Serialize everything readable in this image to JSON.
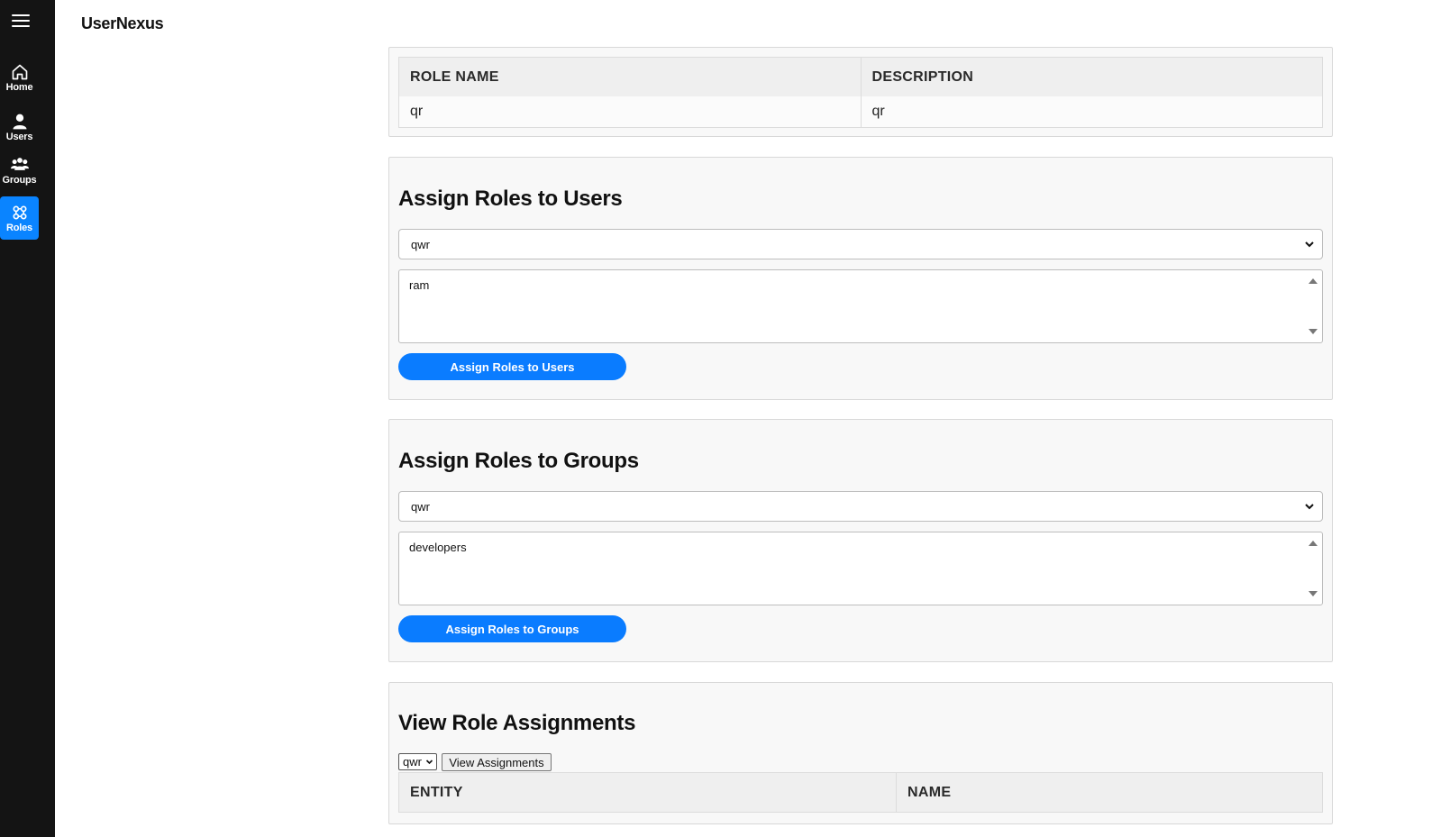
{
  "app": {
    "title": "UserNexus"
  },
  "sidebar": {
    "items": [
      {
        "label": "Home",
        "icon": "home-icon"
      },
      {
        "label": "Users",
        "icon": "user-icon"
      },
      {
        "label": "Groups",
        "icon": "users-group-icon"
      },
      {
        "label": "Roles",
        "icon": "roles-icon",
        "active": true
      }
    ],
    "active_color": "#0a84ff"
  },
  "roles_table": {
    "columns": [
      "ROLE NAME",
      "DESCRIPTION"
    ],
    "rows": [
      [
        "qr",
        "qr"
      ]
    ]
  },
  "assign_users": {
    "title": "Assign Roles to Users",
    "selected_role": "qwr",
    "options": [
      "ram"
    ],
    "button": "Assign Roles to Users"
  },
  "assign_groups": {
    "title": "Assign Roles to Groups",
    "selected_role": "qwr",
    "options": [
      "developers"
    ],
    "button": "Assign Roles to Groups"
  },
  "view_assignments": {
    "title": "View Role Assignments",
    "selected_role": "qwr",
    "button": "View Assignments",
    "columns": [
      "ENTITY",
      "NAME"
    ]
  },
  "colors": {
    "accent": "#0a7cff",
    "sidebar_bg": "#141414"
  }
}
